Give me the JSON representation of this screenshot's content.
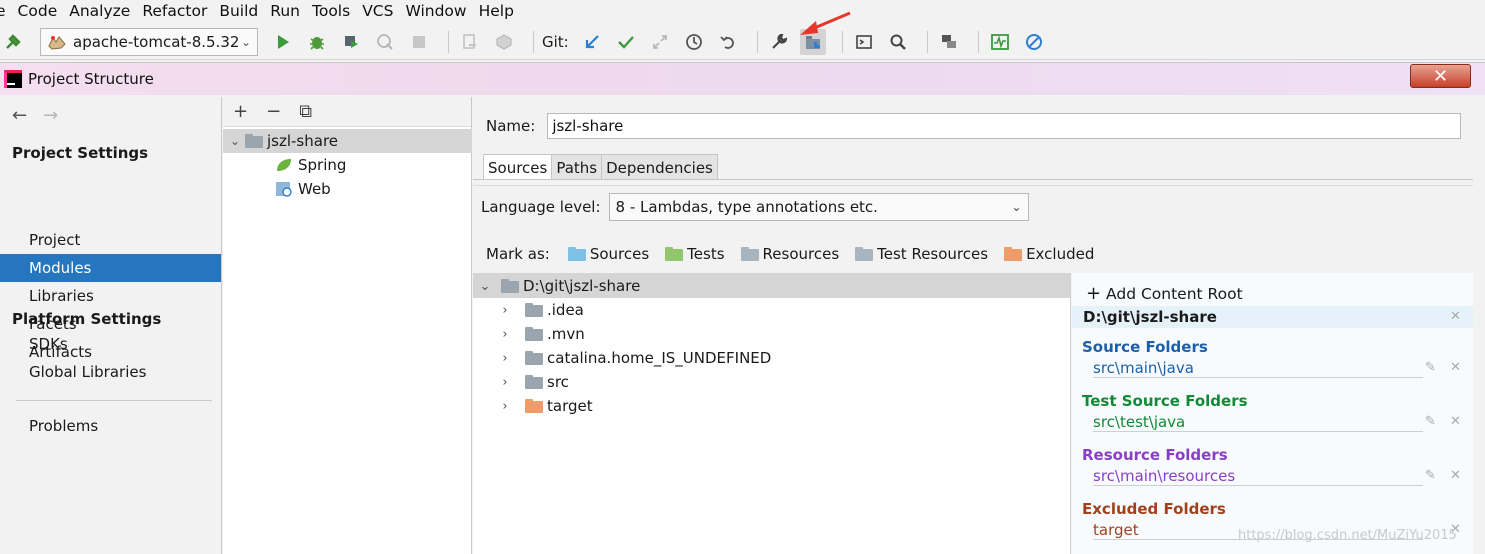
{
  "menu": [
    "e",
    "Code",
    "Analyze",
    "Refactor",
    "Build",
    "Run",
    "Tools",
    "VCS",
    "Window",
    "Help"
  ],
  "toolbar": {
    "run_config": "apache-tomcat-8.5.32",
    "git_label": "Git:"
  },
  "dialog": {
    "title": "Project Structure",
    "close_glyph": "✕"
  },
  "nav": {
    "project_settings_label": "Project Settings",
    "project_settings": [
      "Project",
      "Modules",
      "Libraries",
      "Facets",
      "Artifacts"
    ],
    "platform_settings_label": "Platform Settings",
    "platform_settings": [
      "SDKs",
      "Global Libraries"
    ],
    "problems": "Problems",
    "selected": "Modules"
  },
  "module_tree": {
    "root": "jszl-share",
    "children": [
      "Spring",
      "Web"
    ]
  },
  "module": {
    "name_label": "Name:",
    "name_value": "jszl-share",
    "tabs": [
      "Sources",
      "Paths",
      "Dependencies"
    ],
    "active_tab": "Sources",
    "language_level_label": "Language level:",
    "language_level_value": "8 - Lambdas, type annotations etc.",
    "mark_as_label": "Mark as:",
    "mark_as": [
      "Sources",
      "Tests",
      "Resources",
      "Test Resources",
      "Excluded"
    ]
  },
  "content_tree": {
    "root": "D:\\git\\jszl-share",
    "children": [
      ".idea",
      ".mvn",
      "catalina.home_IS_UNDEFINED",
      "src",
      "target"
    ]
  },
  "summary": {
    "add_content_root": "Add Content Root",
    "root_path": "D:\\git\\jszl-share",
    "source_title": "Source Folders",
    "source_path": "src\\main\\java",
    "test_title": "Test Source Folders",
    "test_path": "src\\test\\java",
    "resource_title": "Resource Folders",
    "resource_path": "src\\main\\resources",
    "excluded_title": "Excluded Folders",
    "excluded_path": "target"
  },
  "watermark": "https://blog.csdn.net/MuZiYu2015",
  "colors": {
    "selection_blue": "#2675bf",
    "source_blue": "#1c5fa8",
    "test_green": "#108a35",
    "resource_purple": "#8a3ec8",
    "excluded_brown": "#a0421d",
    "close_red": "#c6402a"
  }
}
